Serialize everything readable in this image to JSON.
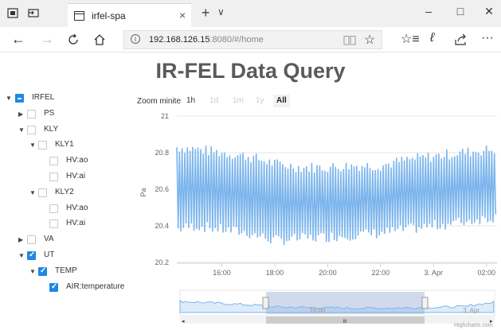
{
  "browser": {
    "tab_title": "irfel-spa",
    "tab_close": "×",
    "new_tab": "+",
    "tab_menu": "∨",
    "url_host": "192.168.126.15",
    "url_rest": ":8080/#/home",
    "minimize": "–",
    "maximize": "□",
    "close": "✕"
  },
  "page": {
    "title": "IR-FEL Data Query"
  },
  "tree": [
    {
      "label": "IRFEL",
      "level": 0,
      "arrow": "down",
      "check": "partial"
    },
    {
      "label": "PS",
      "level": 1,
      "arrow": "right",
      "check": "none"
    },
    {
      "label": "KLY",
      "level": 1,
      "arrow": "down",
      "check": "none"
    },
    {
      "label": "KLY1",
      "level": 2,
      "arrow": "down",
      "check": "none"
    },
    {
      "label": "HV:ao",
      "level": 3,
      "arrow": "",
      "check": "none"
    },
    {
      "label": "HV:ai",
      "level": 3,
      "arrow": "",
      "check": "none"
    },
    {
      "label": "KLY2",
      "level": 2,
      "arrow": "down",
      "check": "none"
    },
    {
      "label": "HV:ao",
      "level": 3,
      "arrow": "",
      "check": "none"
    },
    {
      "label": "HV:ai",
      "level": 3,
      "arrow": "",
      "check": "none"
    },
    {
      "label": "VA",
      "level": 1,
      "arrow": "right",
      "check": "none"
    },
    {
      "label": "UT",
      "level": 1,
      "arrow": "down",
      "check": "checked"
    },
    {
      "label": "TEMP",
      "level": 2,
      "arrow": "down",
      "check": "checked"
    },
    {
      "label": "AIR:temperature",
      "level": 3,
      "arrow": "",
      "check": "checked"
    }
  ],
  "zoom": {
    "label": "Zoom minite",
    "buttons": [
      {
        "label": "1h",
        "state": "active"
      },
      {
        "label": "1d",
        "state": "disabled"
      },
      {
        "label": "1m",
        "state": "disabled"
      },
      {
        "label": "1y",
        "state": "disabled"
      },
      {
        "label": "All",
        "state": "selected"
      }
    ]
  },
  "chart_data": {
    "type": "line",
    "title": "",
    "xlabel": "",
    "ylabel": "Pa",
    "ylim": [
      20.2,
      21.0
    ],
    "yticks": [
      "21",
      "20.8",
      "20.6",
      "20.4",
      "20.2"
    ],
    "xticks": [
      "16:00",
      "18:00",
      "20:00",
      "22:00",
      "3. Apr",
      "02:00"
    ],
    "x_range_hours": [
      14.3,
      26.4
    ],
    "grid": true,
    "legend": "none",
    "series": [
      {
        "color": "#7cb5ec",
        "mean": 20.6,
        "period_minutes": 6,
        "envelope": [
          {
            "x": 14.3,
            "hi": 20.83,
            "lo": 20.38
          },
          {
            "x": 15.0,
            "hi": 20.82,
            "lo": 20.4
          },
          {
            "x": 16.0,
            "hi": 20.8,
            "lo": 20.38
          },
          {
            "x": 17.0,
            "hi": 20.78,
            "lo": 20.36
          },
          {
            "x": 18.0,
            "hi": 20.74,
            "lo": 20.32
          },
          {
            "x": 19.0,
            "hi": 20.72,
            "lo": 20.33
          },
          {
            "x": 20.0,
            "hi": 20.72,
            "lo": 20.34
          },
          {
            "x": 21.0,
            "hi": 20.73,
            "lo": 20.35
          },
          {
            "x": 22.0,
            "hi": 20.73,
            "lo": 20.36
          },
          {
            "x": 23.0,
            "hi": 20.76,
            "lo": 20.38
          },
          {
            "x": 24.0,
            "hi": 20.78,
            "lo": 20.4
          },
          {
            "x": 25.0,
            "hi": 20.8,
            "lo": 20.42
          },
          {
            "x": 26.4,
            "hi": 20.82,
            "lo": 20.45
          }
        ]
      }
    ],
    "navigator": {
      "xticks": [
        "16:00",
        "3. Apr"
      ],
      "selection_from_hours": 14.3,
      "selection_to_hours": 26.4
    }
  },
  "navigator_scroll": {
    "left": "◂",
    "right": "▸",
    "grip": "III"
  },
  "credits": "Highcharts.com",
  "colors": {
    "accent": "#1e88e5",
    "series": "#7cb5ec",
    "grid": "#e6e6e6"
  }
}
